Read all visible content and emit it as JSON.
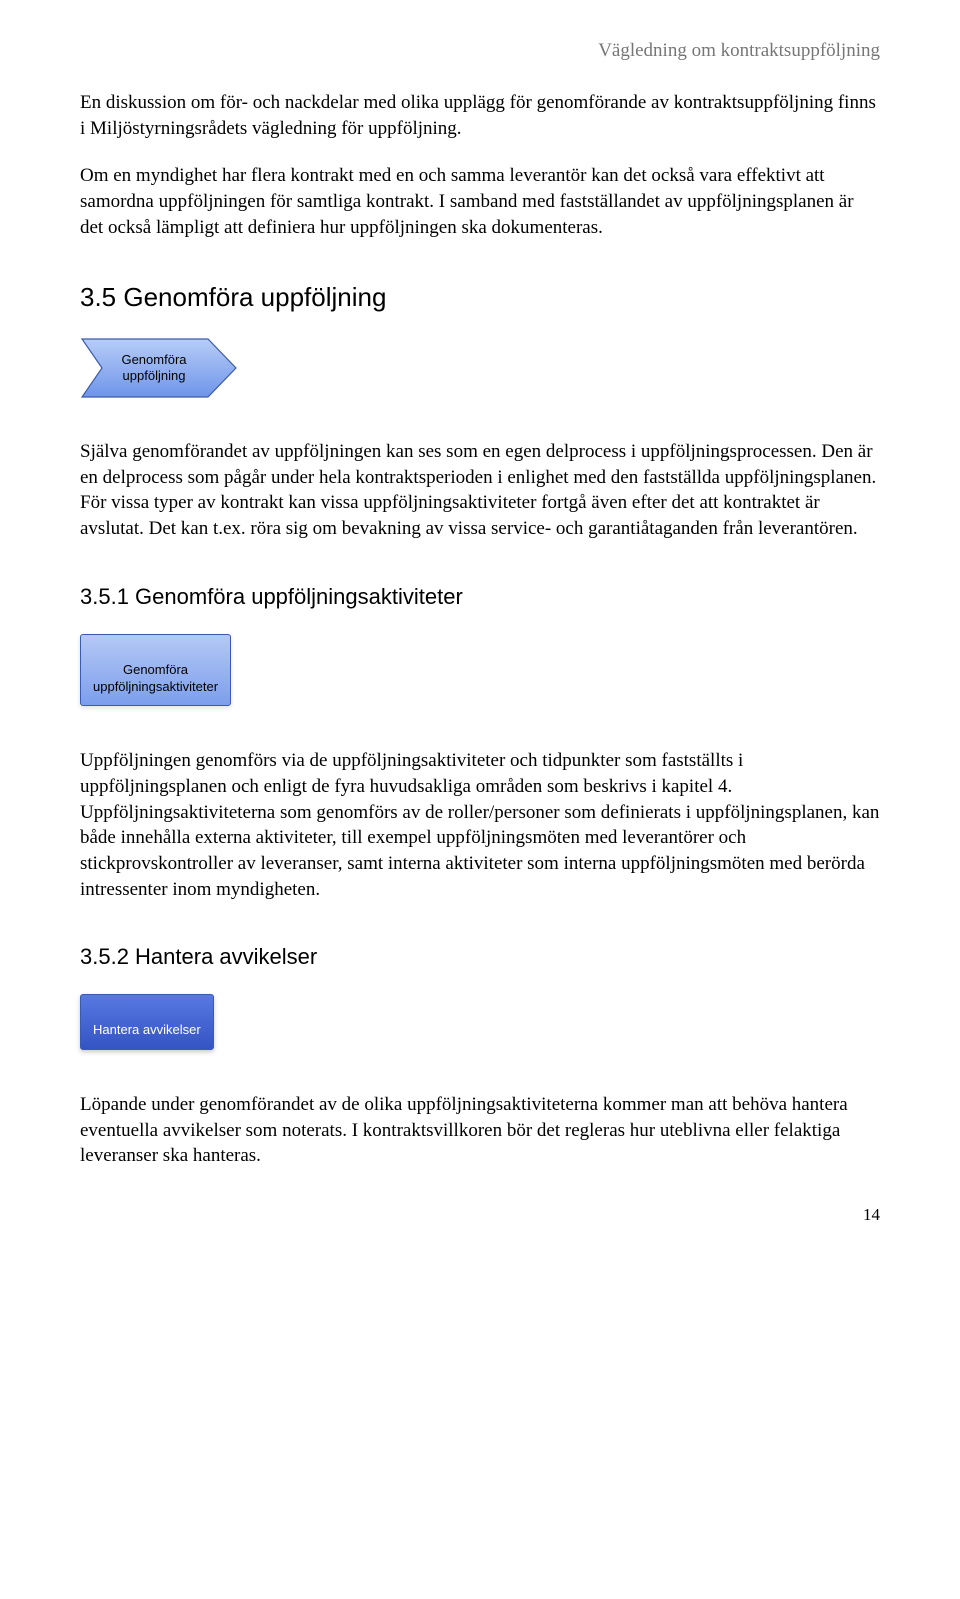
{
  "header": {
    "title": "Vägledning om kontraktsuppföljning"
  },
  "para1": "En diskussion om för- och nackdelar med olika upplägg för genomförande av kontraktsuppföljning finns i Miljöstyrningsrådets vägledning för uppföljning.",
  "para2": "Om en myndighet har flera kontrakt med en och samma leverantör kan det också vara effektivt att samordna uppföljningen för samtliga kontrakt. I samband med fastställandet av uppföljningsplanen är det också lämpligt att definiera hur uppföljningen ska dokumenteras.",
  "section35": {
    "heading": "3.5  Genomföra uppföljning",
    "arrow_label": "Genomföra\nuppföljning",
    "para": "Själva genomförandet av uppföljningen kan ses som en egen delprocess i uppföljningsprocessen. Den är en delprocess som pågår under hela kontraktsperioden i enlighet med den fastställda uppföljningsplanen. För vissa typer av kontrakt kan vissa uppföljningsaktiviteter fortgå även efter det att kontraktet är avslutat. Det kan t.ex. röra sig om bevakning av vissa service- och garantiåtaganden från leverantören."
  },
  "section351": {
    "heading": "3.5.1  Genomföra uppföljningsaktiviteter",
    "box_label": "Genomföra\nuppföljningsaktiviteter",
    "para": "Uppföljningen genomförs via de uppföljningsaktiviteter och tidpunkter som fastställts i uppföljningsplanen och enligt de fyra huvudsakliga områden som beskrivs i kapitel 4. Uppföljningsaktiviteterna som genomförs av de roller/personer som definierats i uppföljningsplanen, kan både innehålla externa aktiviteter, till exempel uppföljningsmöten med leverantörer och stickprovskontroller av leveranser, samt interna aktiviteter som interna uppföljningsmöten med berörda intressenter inom myndigheten."
  },
  "section352": {
    "heading": "3.5.2  Hantera avvikelser",
    "box_label": "Hantera avvikelser",
    "para": "Löpande under genomförandet av de olika uppföljningsaktiviteterna kommer man att behöva hantera eventuella avvikelser som noterats. I kontraktsvillkoren bör det regleras hur uteblivna eller felaktiga leveranser ska hanteras."
  },
  "page_number": "14",
  "colors": {
    "arrow_fill": "#8aaaf2",
    "arrow_stroke": "#3d5aa8",
    "box_light_top": "#b5c9f6",
    "box_light_bot": "#7c9eec",
    "box_dark_top": "#5779e0",
    "box_dark_bot": "#3454c4"
  }
}
